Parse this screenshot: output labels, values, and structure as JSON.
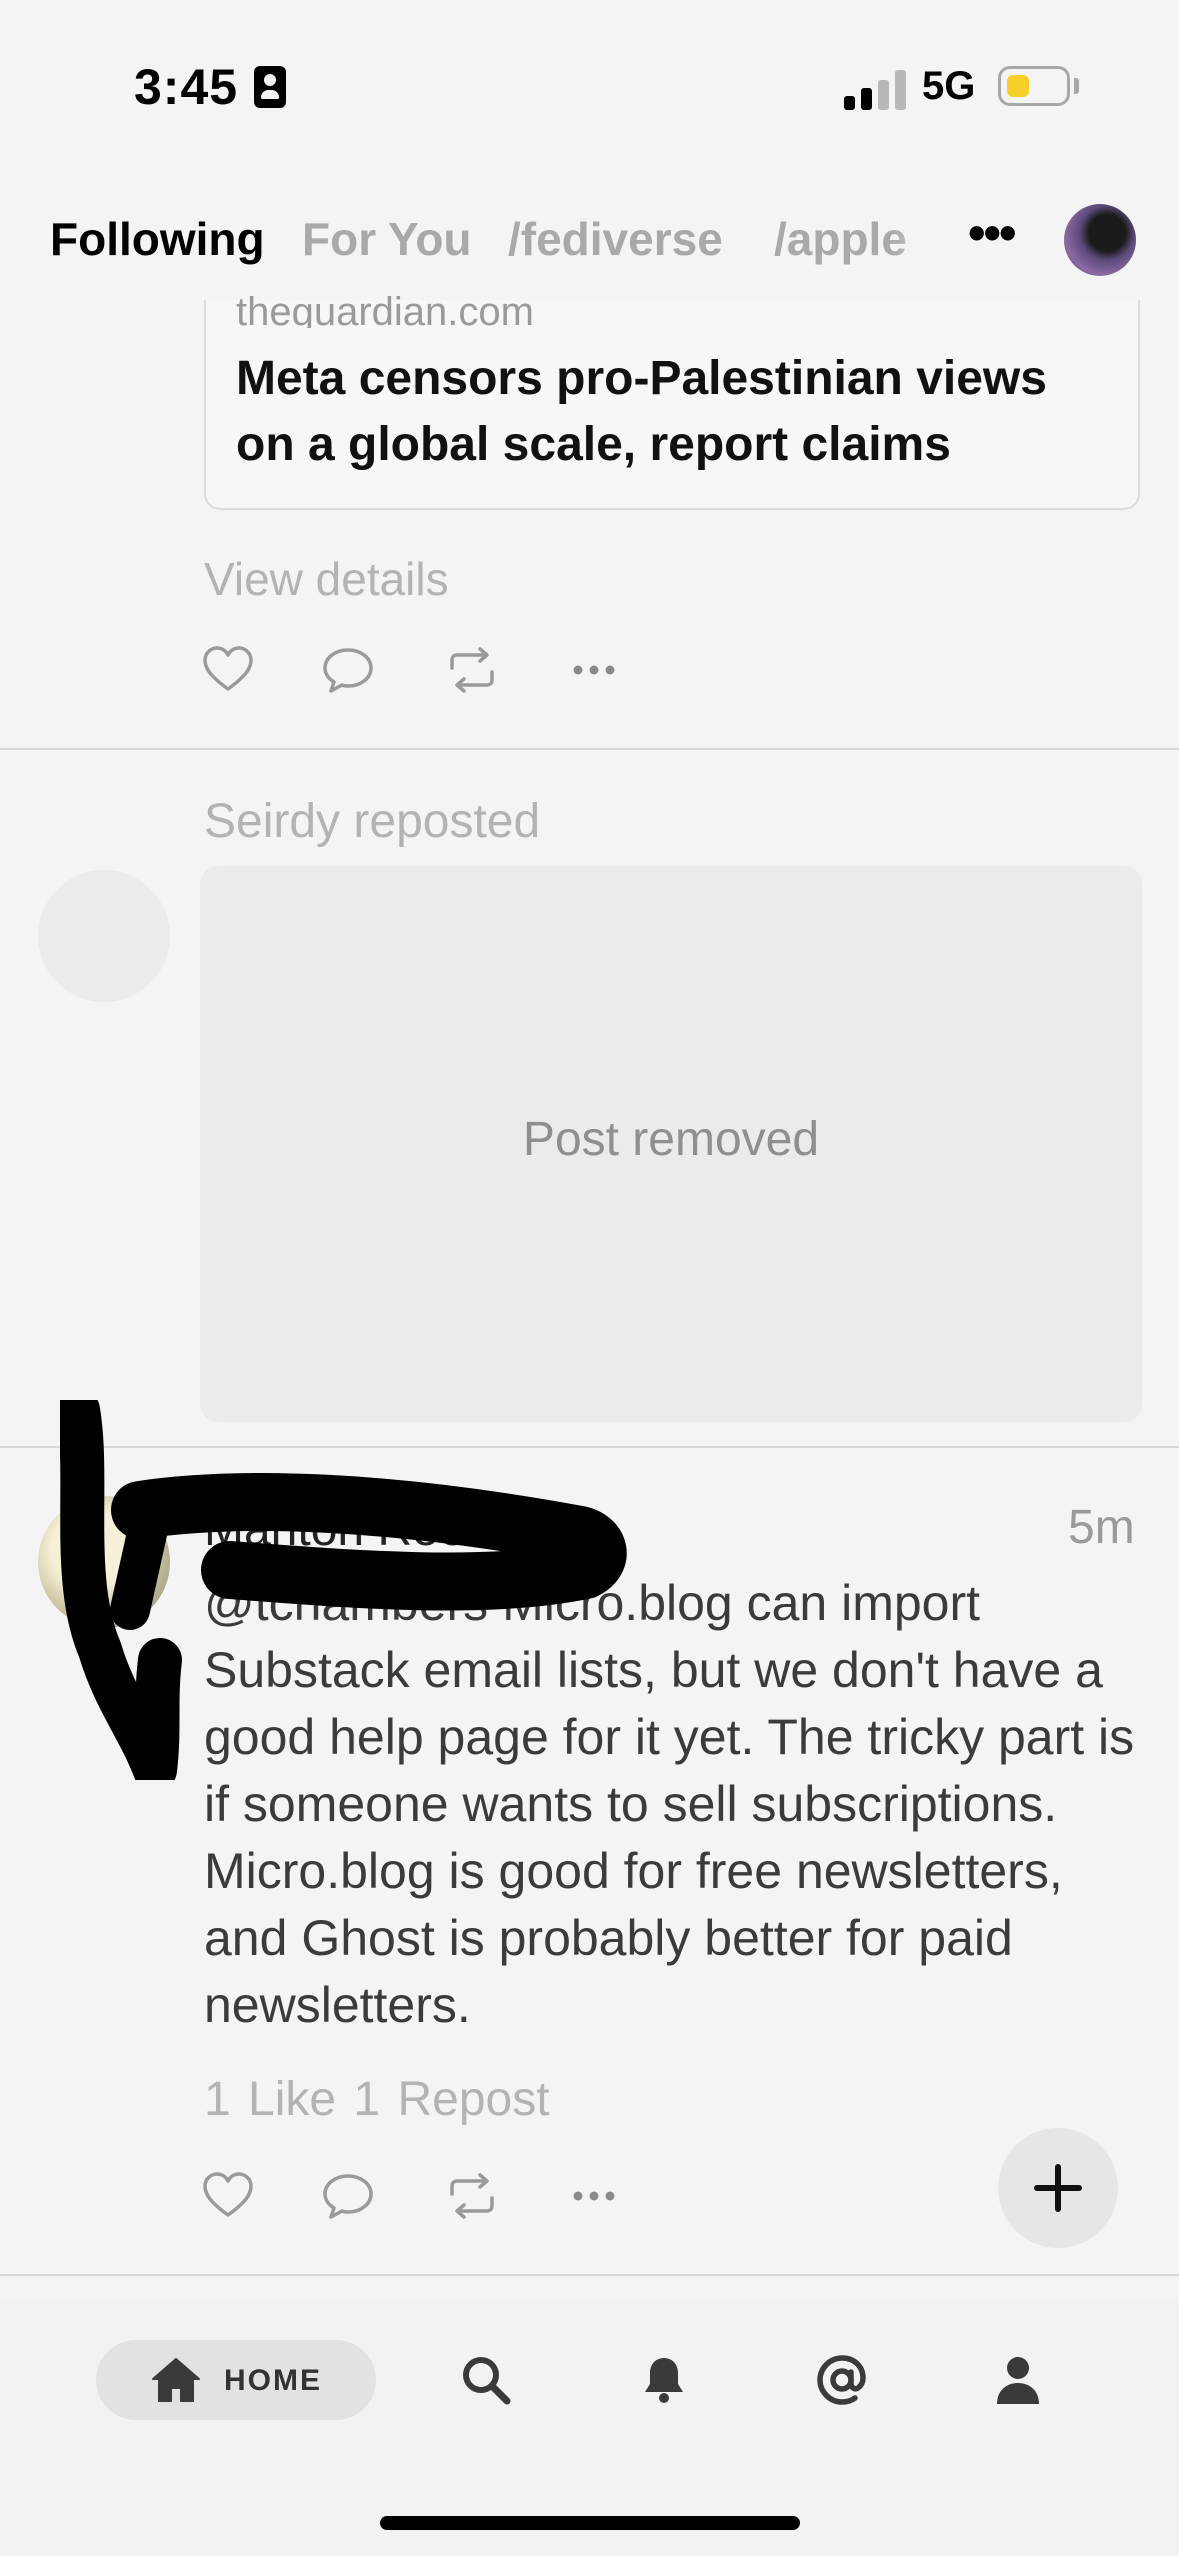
{
  "status_bar": {
    "time": "3:45",
    "network": "5G",
    "battery_level_fraction": 0.2,
    "battery_color": "#f7cf2a"
  },
  "tabs": [
    {
      "label": "Following",
      "active": true
    },
    {
      "label": "For You",
      "active": false
    },
    {
      "label": "/fediverse",
      "active": false
    },
    {
      "label": "/apple",
      "active": false
    }
  ],
  "header": {
    "more_icon": "ellipsis-icon",
    "avatar_icon": "profile-avatar"
  },
  "posts": [
    {
      "link_card": {
        "domain": "theguardian.com",
        "title": "Meta censors pro-Palestinian views on a global scale, report claims"
      },
      "view_details": "View details"
    },
    {
      "repost_label": "Seirdy reposted",
      "removed_text": "Post removed"
    },
    {
      "author": "Manton Reece",
      "time": "5m",
      "mention": "@tchambers",
      "body": " Micro.blog can import Substack email lists, but we don't have a good help page for it yet. The tricky part is if someone wants to sell subscriptions. Micro.blog is good for free newsletters, and Ghost is probably better for paid newsletters.",
      "stats": "1 Like  1 Repost"
    }
  ],
  "bottom_nav": {
    "home_label": "HOME",
    "items": [
      "home-icon",
      "search-icon",
      "bell-icon",
      "at-icon",
      "person-icon"
    ]
  },
  "colors": {
    "background": "#f4f4f4",
    "muted_text": "#b3b3b3",
    "divider": "#d9d9d9"
  }
}
